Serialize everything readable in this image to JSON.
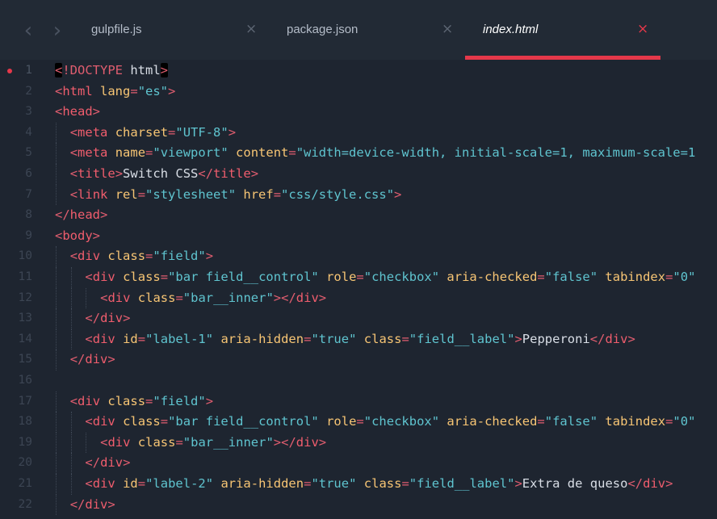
{
  "tabs": [
    {
      "label": "gulpfile.js",
      "active": false
    },
    {
      "label": "package.json",
      "active": false
    },
    {
      "label": "index.html",
      "active": true
    }
  ],
  "tab_close_glyph": "×",
  "nav": {
    "back_glyph": "‹",
    "forward_glyph": "›"
  },
  "colors": {
    "background": "#1e2530",
    "tabbar": "#222a35",
    "accent": "#e5384a",
    "tag": "#f05d6d",
    "attribute": "#f7c574",
    "string": "#5fc4cf",
    "text": "#d9dee6"
  },
  "editor": {
    "modified_line": 1,
    "lines": [
      {
        "num": "1",
        "indent": 0,
        "tokens": [
          [
            "doctype",
            "<!DOCTYPE"
          ],
          [
            "text",
            " "
          ],
          [
            "doctype-name",
            "html"
          ],
          [
            "doctype",
            ">"
          ]
        ]
      },
      {
        "num": "2",
        "indent": 0,
        "tokens": [
          [
            "punct",
            "<"
          ],
          [
            "tag",
            "html"
          ],
          [
            "text",
            " "
          ],
          [
            "attr",
            "lang"
          ],
          [
            "eq",
            "="
          ],
          [
            "str",
            "\"es\""
          ],
          [
            "punct",
            ">"
          ]
        ]
      },
      {
        "num": "3",
        "indent": 0,
        "tokens": [
          [
            "punct",
            "<"
          ],
          [
            "tag",
            "head"
          ],
          [
            "punct",
            ">"
          ]
        ]
      },
      {
        "num": "4",
        "indent": 1,
        "tokens": [
          [
            "punct",
            "<"
          ],
          [
            "tag",
            "meta"
          ],
          [
            "text",
            " "
          ],
          [
            "attr",
            "charset"
          ],
          [
            "eq",
            "="
          ],
          [
            "str",
            "\"UTF-8\""
          ],
          [
            "punct",
            ">"
          ]
        ]
      },
      {
        "num": "5",
        "indent": 1,
        "tokens": [
          [
            "punct",
            "<"
          ],
          [
            "tag",
            "meta"
          ],
          [
            "text",
            " "
          ],
          [
            "attr",
            "name"
          ],
          [
            "eq",
            "="
          ],
          [
            "str",
            "\"viewport\""
          ],
          [
            "text",
            " "
          ],
          [
            "attr",
            "content"
          ],
          [
            "eq",
            "="
          ],
          [
            "str",
            "\"width=device-width, initial-scale=1, maximum-scale=1"
          ]
        ]
      },
      {
        "num": "6",
        "indent": 1,
        "tokens": [
          [
            "punct",
            "<"
          ],
          [
            "tag",
            "title"
          ],
          [
            "punct",
            ">"
          ],
          [
            "text",
            "Switch CSS"
          ],
          [
            "punct",
            "</"
          ],
          [
            "tag",
            "title"
          ],
          [
            "punct",
            ">"
          ]
        ]
      },
      {
        "num": "7",
        "indent": 1,
        "tokens": [
          [
            "punct",
            "<"
          ],
          [
            "tag",
            "link"
          ],
          [
            "text",
            " "
          ],
          [
            "attr",
            "rel"
          ],
          [
            "eq",
            "="
          ],
          [
            "str",
            "\"stylesheet\""
          ],
          [
            "text",
            " "
          ],
          [
            "attr",
            "href"
          ],
          [
            "eq",
            "="
          ],
          [
            "str",
            "\"css/style.css\""
          ],
          [
            "punct",
            ">"
          ]
        ]
      },
      {
        "num": "8",
        "indent": 0,
        "tokens": [
          [
            "punct",
            "</"
          ],
          [
            "tag",
            "head"
          ],
          [
            "punct",
            ">"
          ]
        ]
      },
      {
        "num": "9",
        "indent": 0,
        "tokens": [
          [
            "punct",
            "<"
          ],
          [
            "tag",
            "body"
          ],
          [
            "punct",
            ">"
          ]
        ]
      },
      {
        "num": "10",
        "indent": 1,
        "tokens": [
          [
            "punct",
            "<"
          ],
          [
            "tag",
            "div"
          ],
          [
            "text",
            " "
          ],
          [
            "attr",
            "class"
          ],
          [
            "eq",
            "="
          ],
          [
            "str",
            "\"field\""
          ],
          [
            "punct",
            ">"
          ]
        ]
      },
      {
        "num": "11",
        "indent": 2,
        "tokens": [
          [
            "punct",
            "<"
          ],
          [
            "tag",
            "div"
          ],
          [
            "text",
            " "
          ],
          [
            "attr",
            "class"
          ],
          [
            "eq",
            "="
          ],
          [
            "str",
            "\"bar field__control\""
          ],
          [
            "text",
            " "
          ],
          [
            "attr",
            "role"
          ],
          [
            "eq",
            "="
          ],
          [
            "str",
            "\"checkbox\""
          ],
          [
            "text",
            " "
          ],
          [
            "attr",
            "aria-checked"
          ],
          [
            "eq",
            "="
          ],
          [
            "str",
            "\"false\""
          ],
          [
            "text",
            " "
          ],
          [
            "attr",
            "tabindex"
          ],
          [
            "eq",
            "="
          ],
          [
            "str",
            "\"0\""
          ]
        ]
      },
      {
        "num": "12",
        "indent": 3,
        "tokens": [
          [
            "punct",
            "<"
          ],
          [
            "tag",
            "div"
          ],
          [
            "text",
            " "
          ],
          [
            "attr",
            "class"
          ],
          [
            "eq",
            "="
          ],
          [
            "str",
            "\"bar__inner\""
          ],
          [
            "punct",
            "></"
          ],
          [
            "tag",
            "div"
          ],
          [
            "punct",
            ">"
          ]
        ]
      },
      {
        "num": "13",
        "indent": 2,
        "tokens": [
          [
            "punct",
            "</"
          ],
          [
            "tag",
            "div"
          ],
          [
            "punct",
            ">"
          ]
        ]
      },
      {
        "num": "14",
        "indent": 2,
        "tokens": [
          [
            "punct",
            "<"
          ],
          [
            "tag",
            "div"
          ],
          [
            "text",
            " "
          ],
          [
            "attr",
            "id"
          ],
          [
            "eq",
            "="
          ],
          [
            "str",
            "\"label-1\""
          ],
          [
            "text",
            " "
          ],
          [
            "attr",
            "aria-hidden"
          ],
          [
            "eq",
            "="
          ],
          [
            "str",
            "\"true\""
          ],
          [
            "text",
            " "
          ],
          [
            "attr",
            "class"
          ],
          [
            "eq",
            "="
          ],
          [
            "str",
            "\"field__label\""
          ],
          [
            "punct",
            ">"
          ],
          [
            "text",
            "Pepperoni"
          ],
          [
            "punct",
            "</"
          ],
          [
            "tag",
            "div"
          ],
          [
            "punct",
            ">"
          ]
        ]
      },
      {
        "num": "15",
        "indent": 1,
        "tokens": [
          [
            "punct",
            "</"
          ],
          [
            "tag",
            "div"
          ],
          [
            "punct",
            ">"
          ]
        ]
      },
      {
        "num": "16",
        "indent": 0,
        "tokens": []
      },
      {
        "num": "17",
        "indent": 1,
        "tokens": [
          [
            "punct",
            "<"
          ],
          [
            "tag",
            "div"
          ],
          [
            "text",
            " "
          ],
          [
            "attr",
            "class"
          ],
          [
            "eq",
            "="
          ],
          [
            "str",
            "\"field\""
          ],
          [
            "punct",
            ">"
          ]
        ]
      },
      {
        "num": "18",
        "indent": 2,
        "tokens": [
          [
            "punct",
            "<"
          ],
          [
            "tag",
            "div"
          ],
          [
            "text",
            " "
          ],
          [
            "attr",
            "class"
          ],
          [
            "eq",
            "="
          ],
          [
            "str",
            "\"bar field__control\""
          ],
          [
            "text",
            " "
          ],
          [
            "attr",
            "role"
          ],
          [
            "eq",
            "="
          ],
          [
            "str",
            "\"checkbox\""
          ],
          [
            "text",
            " "
          ],
          [
            "attr",
            "aria-checked"
          ],
          [
            "eq",
            "="
          ],
          [
            "str",
            "\"false\""
          ],
          [
            "text",
            " "
          ],
          [
            "attr",
            "tabindex"
          ],
          [
            "eq",
            "="
          ],
          [
            "str",
            "\"0\""
          ]
        ]
      },
      {
        "num": "19",
        "indent": 3,
        "tokens": [
          [
            "punct",
            "<"
          ],
          [
            "tag",
            "div"
          ],
          [
            "text",
            " "
          ],
          [
            "attr",
            "class"
          ],
          [
            "eq",
            "="
          ],
          [
            "str",
            "\"bar__inner\""
          ],
          [
            "punct",
            "></"
          ],
          [
            "tag",
            "div"
          ],
          [
            "punct",
            ">"
          ]
        ]
      },
      {
        "num": "20",
        "indent": 2,
        "tokens": [
          [
            "punct",
            "</"
          ],
          [
            "tag",
            "div"
          ],
          [
            "punct",
            ">"
          ]
        ]
      },
      {
        "num": "21",
        "indent": 2,
        "tokens": [
          [
            "punct",
            "<"
          ],
          [
            "tag",
            "div"
          ],
          [
            "text",
            " "
          ],
          [
            "attr",
            "id"
          ],
          [
            "eq",
            "="
          ],
          [
            "str",
            "\"label-2\""
          ],
          [
            "text",
            " "
          ],
          [
            "attr",
            "aria-hidden"
          ],
          [
            "eq",
            "="
          ],
          [
            "str",
            "\"true\""
          ],
          [
            "text",
            " "
          ],
          [
            "attr",
            "class"
          ],
          [
            "eq",
            "="
          ],
          [
            "str",
            "\"field__label\""
          ],
          [
            "punct",
            ">"
          ],
          [
            "text",
            "Extra de queso"
          ],
          [
            "punct",
            "</"
          ],
          [
            "tag",
            "div"
          ],
          [
            "punct",
            ">"
          ]
        ]
      },
      {
        "num": "22",
        "indent": 1,
        "tokens": [
          [
            "punct",
            "</"
          ],
          [
            "tag",
            "div"
          ],
          [
            "punct",
            ">"
          ]
        ]
      }
    ]
  }
}
